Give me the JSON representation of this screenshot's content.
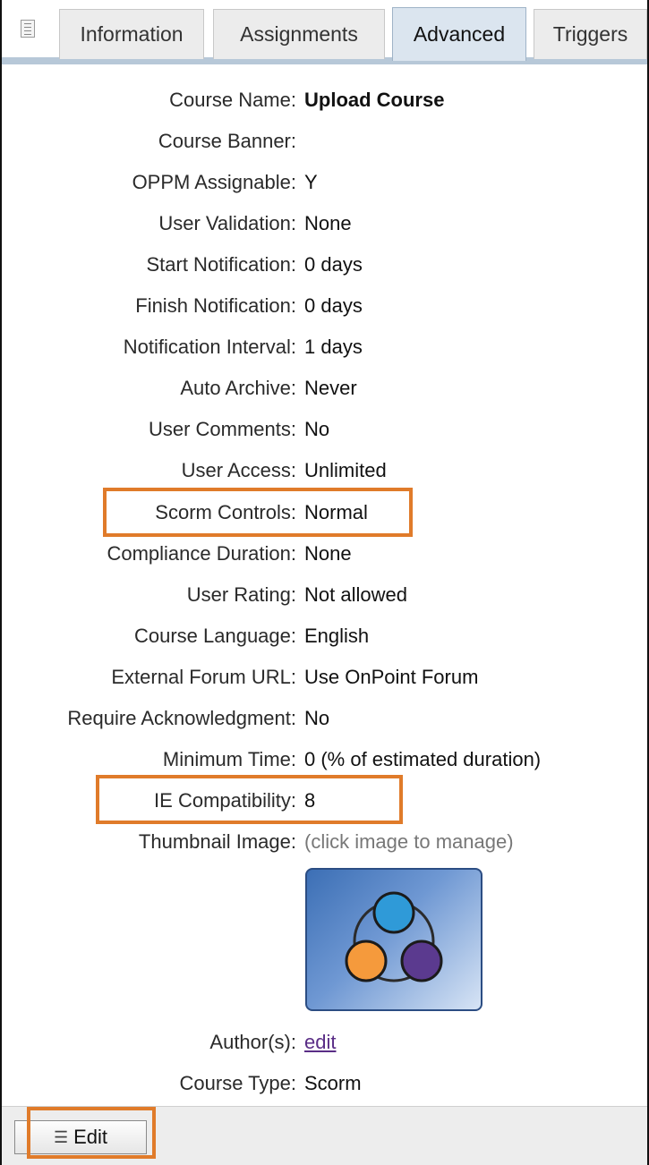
{
  "tabs": [
    {
      "label": "Information",
      "active": false
    },
    {
      "label": "Assignments",
      "active": false
    },
    {
      "label": "Advanced",
      "active": true
    },
    {
      "label": "Triggers",
      "active": false
    }
  ],
  "fields": [
    {
      "label": "Course Name:",
      "value": "Upload Course"
    },
    {
      "label": "Course Banner:",
      "value": ""
    },
    {
      "label": "OPPM Assignable:",
      "value": "Y"
    },
    {
      "label": "User Validation:",
      "value": "None"
    },
    {
      "label": "Start Notification:",
      "value": "0 days"
    },
    {
      "label": "Finish Notification:",
      "value": "0 days"
    },
    {
      "label": "Notification Interval:",
      "value": "1 days"
    },
    {
      "label": "Auto Archive:",
      "value": "Never"
    },
    {
      "label": "User Comments:",
      "value": "No"
    },
    {
      "label": "User Access:",
      "value": "Unlimited"
    },
    {
      "label": "Scorm Controls:",
      "value": "Normal"
    },
    {
      "label": "Compliance Duration:",
      "value": "None"
    },
    {
      "label": "User Rating:",
      "value": "Not allowed"
    },
    {
      "label": "Course Language:",
      "value": "English"
    },
    {
      "label": "External Forum URL:",
      "value": "Use OnPoint Forum"
    },
    {
      "label": "Require Acknowledgment:",
      "value": "No"
    },
    {
      "label": "Minimum Time:",
      "value": "0 (% of estimated duration)"
    },
    {
      "label": "IE Compatibility:",
      "value": "8"
    },
    {
      "label": "Thumbnail Image:",
      "value": "(click image to manage)"
    },
    {
      "label": "Author(s):",
      "value": "edit"
    },
    {
      "label": "Course Type:",
      "value": "Scorm"
    }
  ],
  "footer": {
    "edit_label": "Edit"
  },
  "colors": {
    "highlight": "#e07b2a",
    "active_tab": "#dbe5ef",
    "tab_strip": "#b7c8d8"
  }
}
